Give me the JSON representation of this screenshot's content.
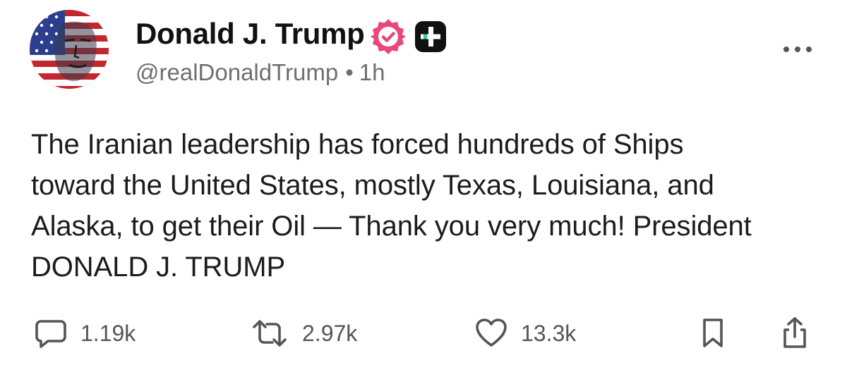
{
  "post": {
    "author": {
      "display_name": "Donald J. Trump",
      "handle": "@realDonaldTrump",
      "timestamp": "1h",
      "separator": "•",
      "avatar_icon": "portrait-avatar-flag",
      "verified_icon": "verified-badge-icon",
      "verified_color": "#e8487a",
      "plus_icon": "plus-badge-icon"
    },
    "more_icon": "more-options-icon",
    "text_lines": [
      "The Iranian leadership has forced hundreds of Ships",
      "toward the United States, mostly Texas, Louisiana, and",
      "Alaska, to get their Oil — Thank you very much! President",
      "DONALD J. TRUMP"
    ],
    "actions": {
      "reply": {
        "icon": "reply-icon",
        "count": "1.19k"
      },
      "repost": {
        "icon": "repost-icon",
        "count": "2.97k"
      },
      "like": {
        "icon": "heart-icon",
        "count": "13.3k"
      },
      "bookmark": {
        "icon": "bookmark-icon"
      },
      "share": {
        "icon": "share-icon"
      }
    }
  }
}
